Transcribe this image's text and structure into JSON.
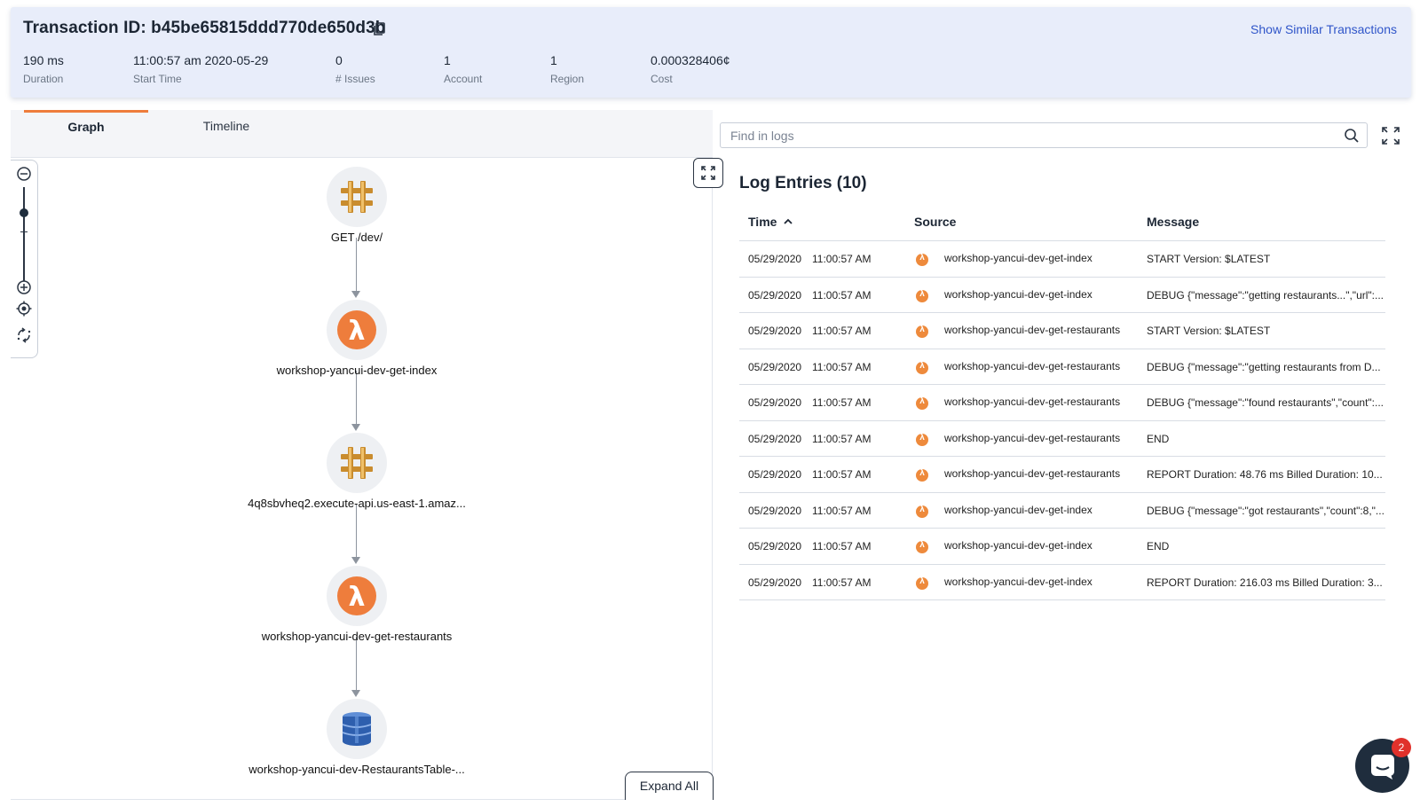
{
  "header": {
    "title": "Transaction ID: b45be65815ddd770de650d3b",
    "similar_link": "Show Similar Transactions",
    "stats": [
      {
        "value": "190 ms",
        "label": "Duration"
      },
      {
        "value": "11:00:57 am 2020-05-29",
        "label": "Start Time"
      },
      {
        "value": "0",
        "label": "# Issues"
      },
      {
        "value": "1",
        "label": "Account"
      },
      {
        "value": "1",
        "label": "Region"
      },
      {
        "value": "0.000328406¢",
        "label": "Cost"
      }
    ]
  },
  "tabs": [
    {
      "label": "Graph",
      "active": true
    },
    {
      "label": "Timeline",
      "active": false
    }
  ],
  "graph": {
    "nodes": [
      {
        "label": "GET /dev/",
        "icon": "api-gateway-icon"
      },
      {
        "label": "workshop-yancui-dev-get-index",
        "icon": "lambda-icon"
      },
      {
        "label": "4q8sbvheq2.execute-api.us-east-1.amaz...",
        "icon": "api-gateway-icon"
      },
      {
        "label": "workshop-yancui-dev-get-restaurants",
        "icon": "lambda-icon"
      },
      {
        "label": "workshop-yancui-dev-RestaurantsTable-...",
        "icon": "dynamodb-icon"
      }
    ],
    "expand_all_label": "Expand All"
  },
  "logs": {
    "search_placeholder": "Find in logs",
    "title": "Log Entries (10)",
    "columns": {
      "time": "Time",
      "source": "Source",
      "message": "Message"
    },
    "rows": [
      {
        "date": "05/29/2020",
        "time": "11:00:57 AM",
        "source": "workshop-yancui-dev-get-index",
        "message": "START Version: $LATEST"
      },
      {
        "date": "05/29/2020",
        "time": "11:00:57 AM",
        "source": "workshop-yancui-dev-get-index",
        "message": "DEBUG {\"message\":\"getting restaurants...\",\"url\":..."
      },
      {
        "date": "05/29/2020",
        "time": "11:00:57 AM",
        "source": "workshop-yancui-dev-get-restaurants",
        "message": "START Version: $LATEST"
      },
      {
        "date": "05/29/2020",
        "time": "11:00:57 AM",
        "source": "workshop-yancui-dev-get-restaurants",
        "message": "DEBUG {\"message\":\"getting restaurants from D..."
      },
      {
        "date": "05/29/2020",
        "time": "11:00:57 AM",
        "source": "workshop-yancui-dev-get-restaurants",
        "message": "DEBUG {\"message\":\"found restaurants\",\"count\":..."
      },
      {
        "date": "05/29/2020",
        "time": "11:00:57 AM",
        "source": "workshop-yancui-dev-get-restaurants",
        "message": "END"
      },
      {
        "date": "05/29/2020",
        "time": "11:00:57 AM",
        "source": "workshop-yancui-dev-get-restaurants",
        "message": "REPORT Duration: 48.76 ms Billed Duration: 10..."
      },
      {
        "date": "05/29/2020",
        "time": "11:00:57 AM",
        "source": "workshop-yancui-dev-get-index",
        "message": "DEBUG {\"message\":\"got restaurants\",\"count\":8,\"..."
      },
      {
        "date": "05/29/2020",
        "time": "11:00:57 AM",
        "source": "workshop-yancui-dev-get-index",
        "message": "END"
      },
      {
        "date": "05/29/2020",
        "time": "11:00:57 AM",
        "source": "workshop-yancui-dev-get-index",
        "message": "REPORT Duration: 216.03 ms Billed Duration: 3..."
      }
    ]
  },
  "chat": {
    "badge_count": "2"
  },
  "colors": {
    "accent": "#ee7d3c",
    "lambda": "#ee8a3c",
    "link": "#2f55c9",
    "header_bg": "#e8edfa",
    "badge": "#e0312b"
  }
}
